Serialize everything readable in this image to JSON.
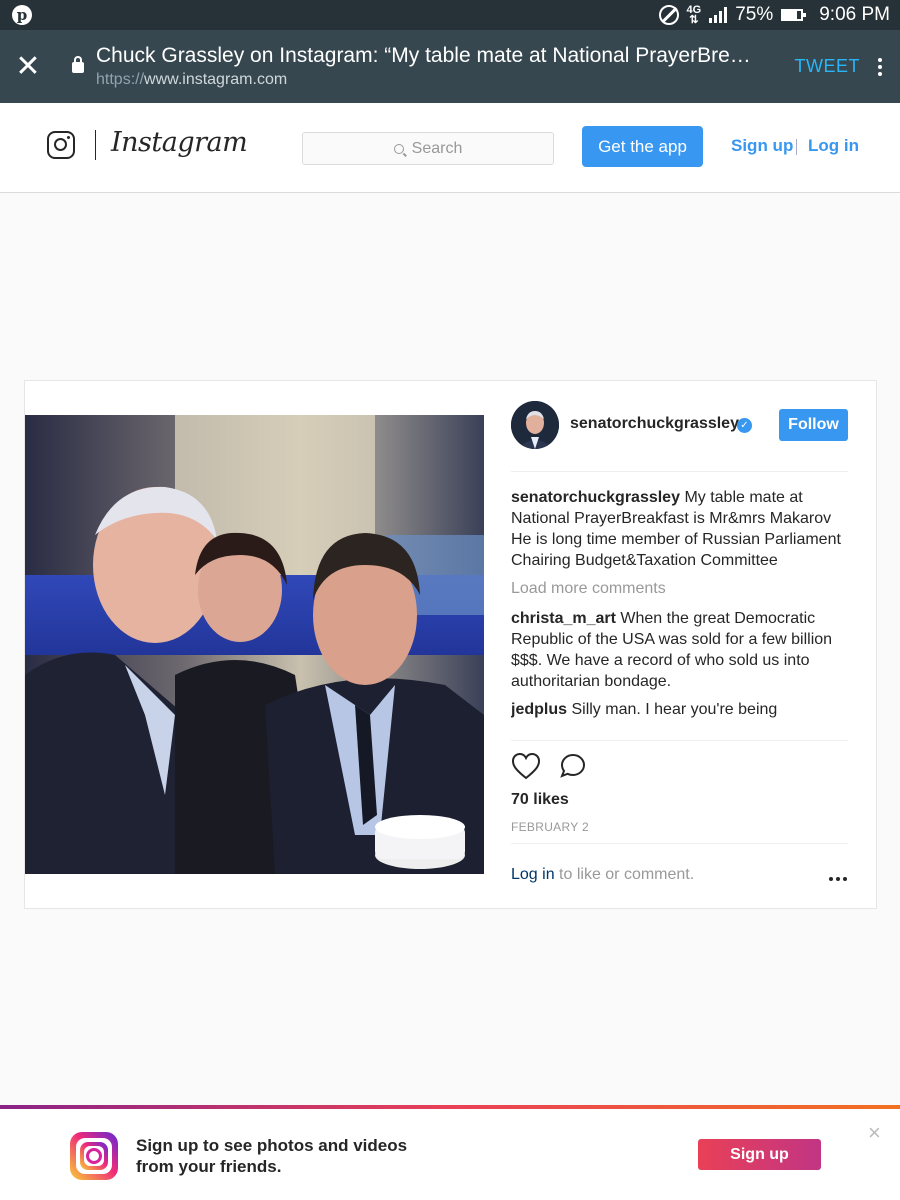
{
  "status_bar": {
    "network": "4G",
    "battery": "75%",
    "time": "9:06 PM",
    "icons": [
      "pinterest-icon",
      "no-sim-icon",
      "network-icon",
      "signal-icon",
      "battery-icon"
    ]
  },
  "browser": {
    "page_title": "Chuck Grassley on Instagram: “My table mate at National PrayerBre…",
    "url_protocol": "https://",
    "url_host": "www.instagram.com",
    "tweet_label": "TWEET"
  },
  "ig_header": {
    "wordmark": "Instagram",
    "search_placeholder": "Search",
    "get_app_label": "Get the app",
    "sign_up_label": "Sign up",
    "log_in_label": "Log in"
  },
  "post": {
    "username": "senatorchuckgrassley",
    "follow_label": "Follow",
    "caption": {
      "user": "senatorchuckgrassley",
      "text": "My table mate at National PrayerBreakfast is Mr&mrs Makarov He is long time member of Russian Parliament Chairing Budget&Taxation Committee"
    },
    "load_more_label": "Load more comments",
    "comments": [
      {
        "user": "christa_m_art",
        "text": "When the great Democratic Republic of the USA was sold for a few billion $$$. We have a record of who sold us into authoritarian bondage."
      },
      {
        "user": "jedplus",
        "text": "Silly man. I hear you're being"
      }
    ],
    "likes": "70 likes",
    "date": "FEBRUARY 2",
    "login_link": "Log in",
    "login_rest": " to like or comment."
  },
  "banner": {
    "line1": "Sign up to see photos and videos",
    "line2": "from your friends.",
    "signup_label": "Sign up",
    "close": "×"
  },
  "colors": {
    "status_bar": "#263238",
    "browser_bar": "#37474f",
    "ig_blue": "#3897f0",
    "tweet": "#29b6f6"
  }
}
